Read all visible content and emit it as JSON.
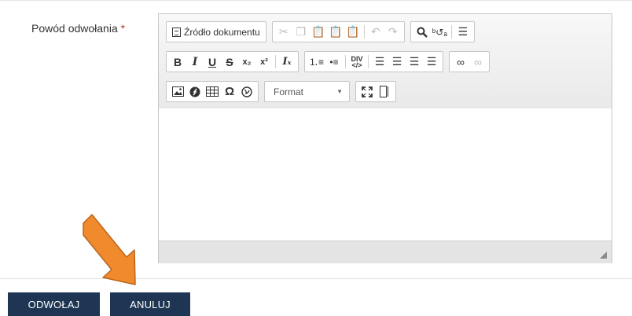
{
  "form": {
    "field_label": "Powód odwołania",
    "required_mark": "*"
  },
  "editor": {
    "source_label": "Źródło dokumentu",
    "format_label": "Format",
    "content": ""
  },
  "actions": {
    "submit_label": "ODWOŁAJ",
    "cancel_label": "ANULUJ"
  },
  "colors": {
    "button_bg": "#1e3654",
    "arrow": "#f08a2c",
    "required": "#c0392b"
  }
}
